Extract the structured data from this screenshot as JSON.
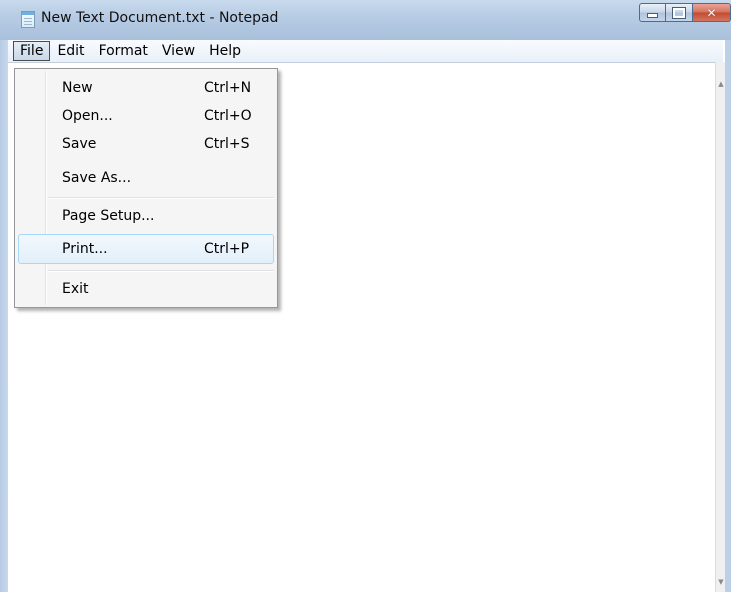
{
  "window": {
    "title": "New Text Document.txt - Notepad"
  },
  "menubar": {
    "items": [
      {
        "label": "File",
        "active": true
      },
      {
        "label": "Edit"
      },
      {
        "label": "Format"
      },
      {
        "label": "View"
      },
      {
        "label": "Help"
      }
    ]
  },
  "file_menu": {
    "items": [
      {
        "label": "New",
        "shortcut": "Ctrl+N"
      },
      {
        "label": "Open...",
        "shortcut": "Ctrl+O"
      },
      {
        "label": "Save",
        "shortcut": "Ctrl+S"
      },
      {
        "label": "Save As...",
        "shortcut": ""
      },
      {
        "label": "Page Setup...",
        "shortcut": ""
      },
      {
        "label": "Print...",
        "shortcut": "Ctrl+P",
        "highlighted": true
      },
      {
        "label": "Exit",
        "shortcut": ""
      }
    ]
  },
  "editor": {
    "content": ""
  },
  "icons": {
    "app": "notepad-icon",
    "minimize": "minimize-icon",
    "maximize": "maximize-icon",
    "close": "close-icon",
    "scroll_up": "scroll-up-arrow-icon",
    "scroll_down": "scroll-down-arrow-icon"
  },
  "colors": {
    "titlebar": "#b6cbe3",
    "close_button": "#c44a2f",
    "menu_highlight": "#e2effa",
    "menu_highlight_border": "#a8d8f7"
  }
}
